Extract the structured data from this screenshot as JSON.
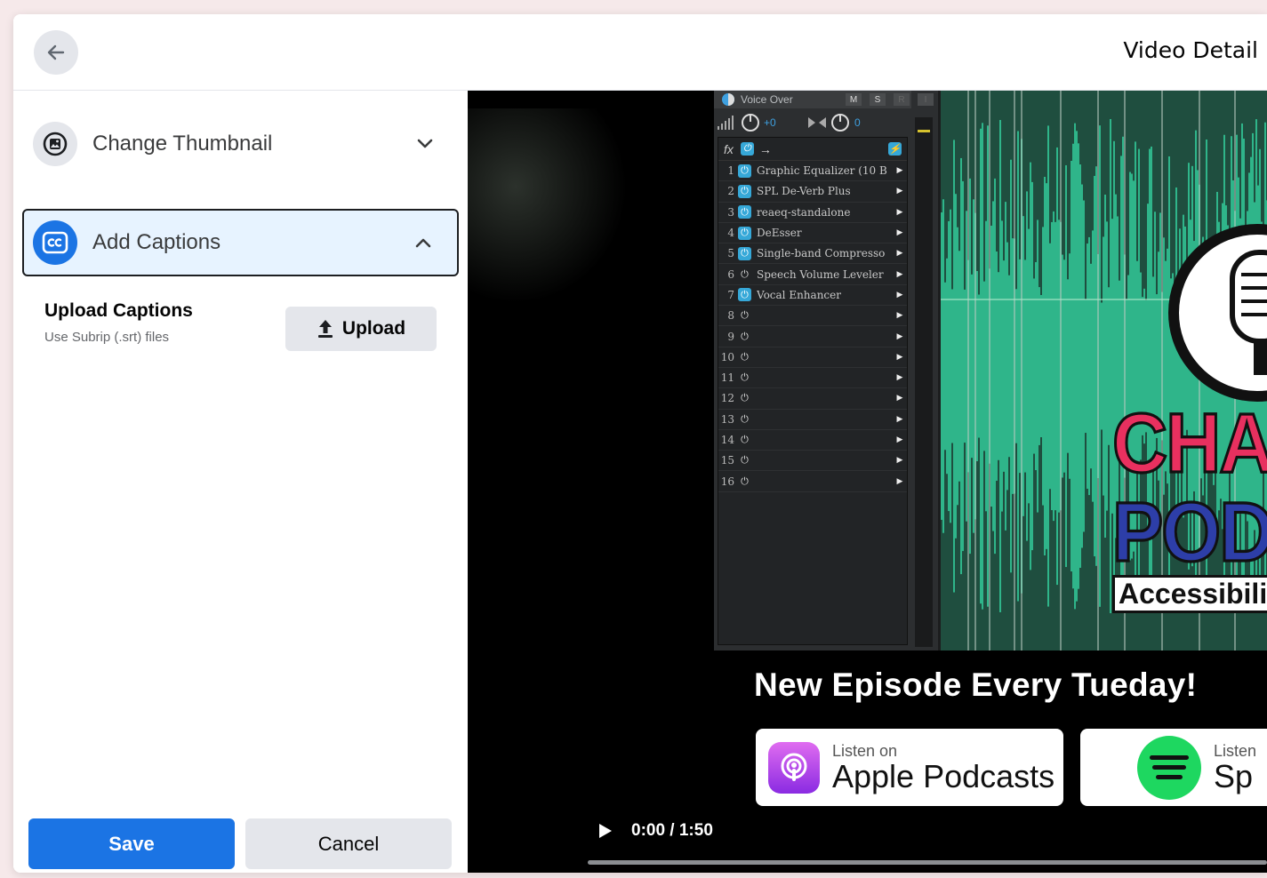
{
  "header": {
    "title": "Video Detail"
  },
  "sidebar": {
    "thumbnail_label": "Change Thumbnail",
    "captions_label": "Add Captions",
    "upload_title": "Upload Captions",
    "upload_sub": "Use Subrip (.srt) files",
    "upload_button": "Upload",
    "save_button": "Save",
    "cancel_button": "Cancel"
  },
  "video": {
    "mixer": {
      "track_name": "Voice Over",
      "m_label": "M",
      "s_label": "S",
      "r_label": "R",
      "i_label": "I",
      "vol_label": "+0",
      "pan_label": "0",
      "fx_label": "fx",
      "effects": [
        {
          "num": "1",
          "name": "Graphic Equalizer (10 B",
          "on": true
        },
        {
          "num": "2",
          "name": "SPL De-Verb Plus",
          "on": true
        },
        {
          "num": "3",
          "name": "reaeq-standalone",
          "on": true
        },
        {
          "num": "4",
          "name": "DeEsser",
          "on": true
        },
        {
          "num": "5",
          "name": "Single-band Compresso",
          "on": true
        },
        {
          "num": "6",
          "name": "Speech Volume Leveler",
          "on": false
        },
        {
          "num": "7",
          "name": "Vocal Enhancer",
          "on": true
        },
        {
          "num": "8",
          "name": "",
          "on": false
        },
        {
          "num": "9",
          "name": "",
          "on": false
        },
        {
          "num": "10",
          "name": "",
          "on": false
        },
        {
          "num": "11",
          "name": "",
          "on": false
        },
        {
          "num": "12",
          "name": "",
          "on": false
        },
        {
          "num": "13",
          "name": "",
          "on": false
        },
        {
          "num": "14",
          "name": "",
          "on": false
        },
        {
          "num": "15",
          "name": "",
          "on": false
        },
        {
          "num": "16",
          "name": "",
          "on": false
        }
      ]
    },
    "logo_line1": "CHAX",
    "logo_line2": "PODC",
    "logo_line3": "Accessibility",
    "episode_text": "New Episode Every Tueday!",
    "apple_small": "Listen on",
    "apple_big": "Apple Podcasts",
    "spotify_small": "Listen",
    "spotify_big": "Sp",
    "time_display": "0:00 / 1:50",
    "progress_fraction": 0
  },
  "colors": {
    "accent": "#1b74e4",
    "selected_bg": "#e7f3ff",
    "button_gray": "#e4e6eb",
    "wave_green": "#2fb58a"
  }
}
